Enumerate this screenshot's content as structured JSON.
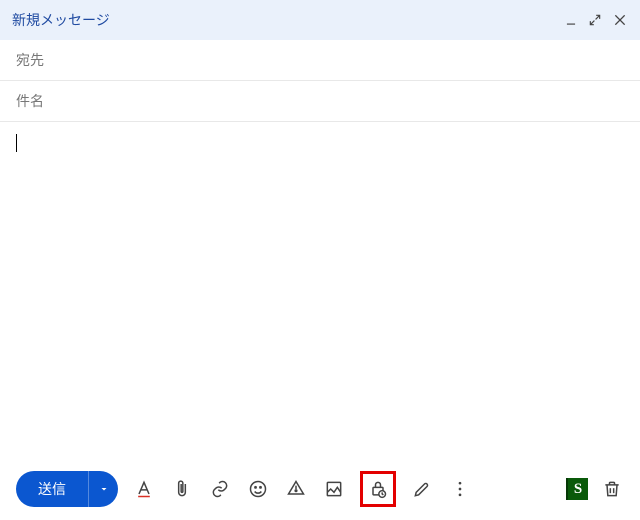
{
  "header": {
    "title": "新規メッセージ"
  },
  "fields": {
    "to_label": "宛先",
    "subject_label": "件名"
  },
  "toolbar": {
    "send_label": "送信"
  }
}
